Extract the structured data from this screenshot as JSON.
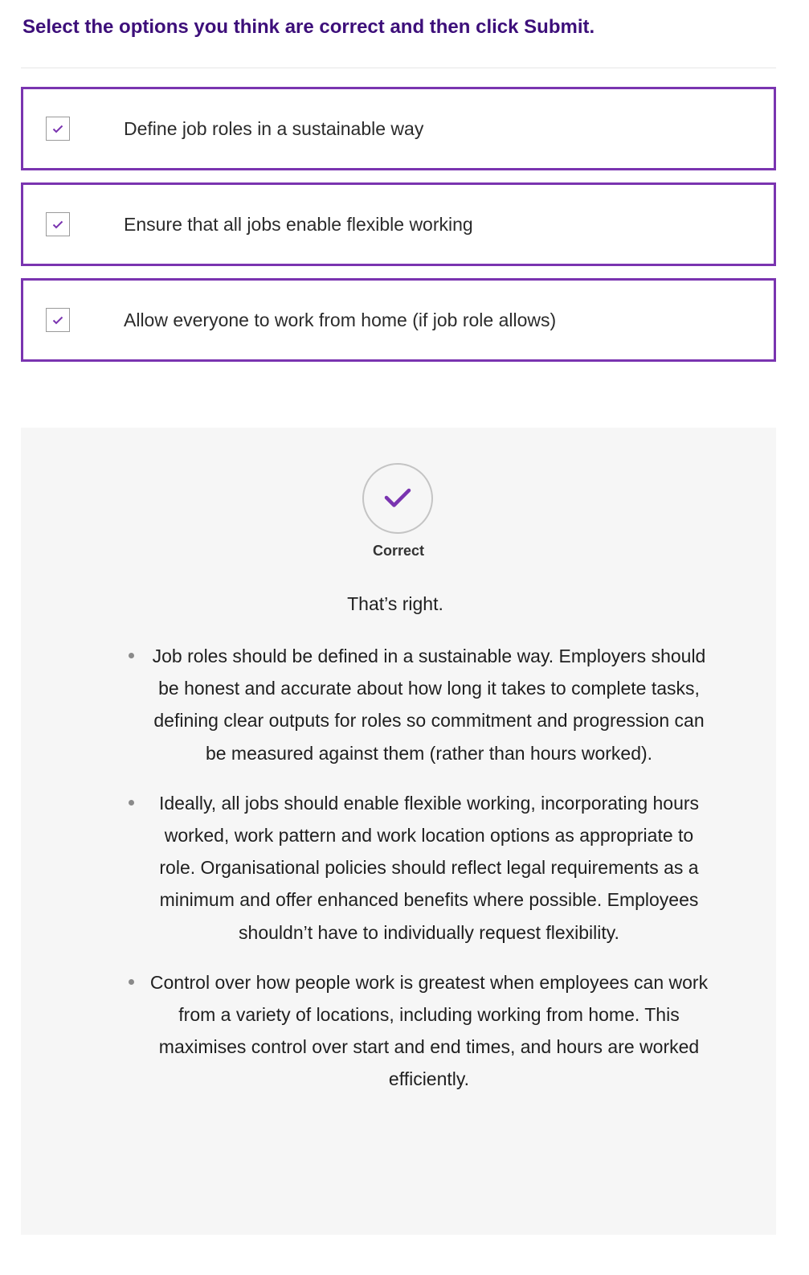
{
  "question": {
    "instruction": "Select the options you think are correct and then click Submit."
  },
  "options": [
    {
      "label": "Define job roles in a sustainable way",
      "checked": true
    },
    {
      "label": "Ensure that all jobs enable flexible working",
      "checked": true
    },
    {
      "label": "Allow everyone to work from home (if job role allows)",
      "checked": true
    }
  ],
  "feedback": {
    "status_icon": "check-circle-icon",
    "status": "Correct",
    "heading": "That’s right.",
    "points": [
      "Job roles should be defined in a sustainable way. Employers should be honest and accurate about how long it takes to complete tasks, defining clear outputs for roles so commitment and progression can be measured against them (rather than hours worked).",
      "Ideally, all jobs should enable flexible working, incorporating hours worked, work pattern and work location options as appropriate to role. Organisational policies should reflect legal requirements as a minimum and offer enhanced benefits where possible.  Employees shouldn’t have to individually request flexibility.",
      "Control over how people work is greatest when employees can work from a variety of locations, including working from home. This maximises control over start and end times, and hours are worked efficiently."
    ]
  },
  "colors": {
    "accent": "#7a34b0",
    "heading": "#3d0f7a",
    "panel_background": "#f6f6f6"
  }
}
